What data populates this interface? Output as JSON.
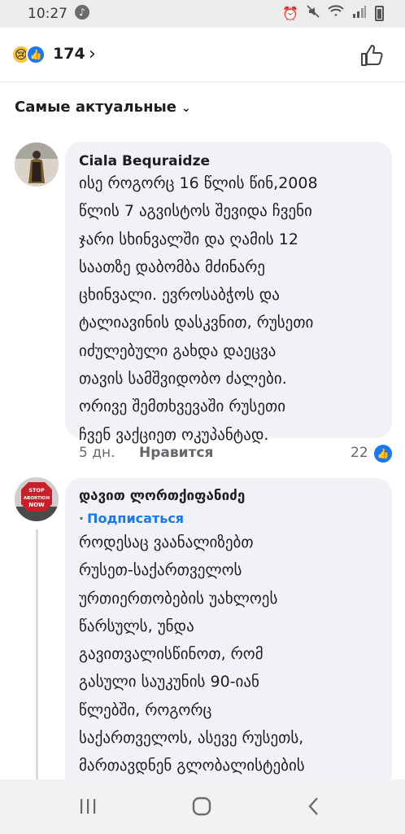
{
  "status": {
    "time": "10:27"
  },
  "reactions": {
    "count": "174",
    "icons": [
      "sad-emoji",
      "like-emoji"
    ]
  },
  "sort": {
    "label": "Самые актуальные"
  },
  "comments": [
    {
      "author": "Ciala Bequraidze",
      "text": "ისე  როგორც 16 წლის წინ,2008 \nწლის 7 აგვისტოს შევიდა ჩვენი \nჯარი სხინვალში და ღამის 12 \nსაათზე დაბომბა მძინარე \nცხინვალი. ევროსაბჭოს  და \nტალიავინის დასკვნით, რუსეთი \nიძულებული გახდა დაეცვა \nთავის სამშვიდობო ძალები. \nორივე შემთხვევაში რუსეთი \nჩვენ ვაქციეთ ოკუპანტად.",
      "age": "5 дн.",
      "like_label": "Нравится",
      "like_count": "22"
    },
    {
      "author": "დავით ლორთქიფანიძე",
      "follow_label": "Подписаться",
      "avatar_sign": "STOP ABORTION NOW",
      "text": "როდესაც ვაანალიზებთ \nრუსეთ-საქართველოს \nურთიერთობების უახლოეს \nწარსულს, უნდა \nგავითვალისწინოთ, რომ \nგასული საუკუნის 90-იან \nწლებში, როგორც \nსაქართველოს, ასევე რუსეთს, \nმართავდნენ გლობალისტების"
    }
  ]
}
